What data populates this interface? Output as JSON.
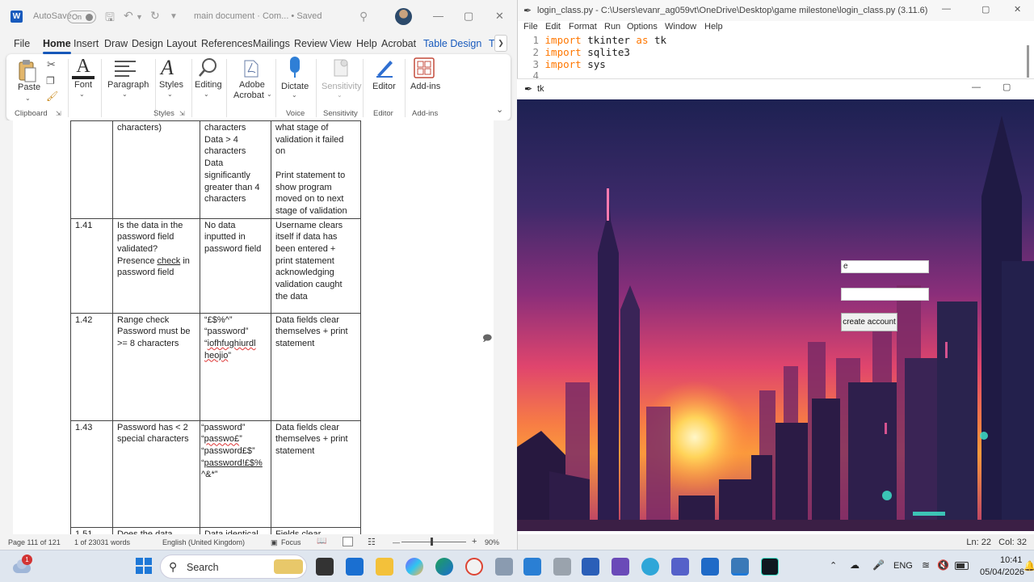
{
  "word": {
    "autosave_label": "AutoSave",
    "autosave_state": "On",
    "doc_title": "main document  ·  Com...  •  Saved",
    "menu": [
      "File",
      "Home",
      "Insert",
      "Draw",
      "Design",
      "Layout",
      "References",
      "Mailings",
      "Review",
      "View",
      "Help",
      "Acrobat",
      "Table Design",
      "T"
    ],
    "ribbon": {
      "paste": "Paste",
      "font": "Font",
      "paragraph": "Paragraph",
      "styles": "Styles",
      "editing": "Editing",
      "adobe1": "Adobe",
      "adobe2": "Acrobat",
      "dictate": "Dictate",
      "sensitivity": "Sensitivity",
      "editor": "Editor",
      "addins": "Add-ins",
      "grp_clipboard": "Clipboard",
      "grp_styles": "Styles",
      "grp_voice": "Voice",
      "grp_sensitivity": "Sensitivity",
      "grp_editor": "Editor",
      "grp_addins": "Add-ins"
    },
    "table": {
      "r0": {
        "c1": "characters)",
        "c2": "characters\nData > 4\ncharacters\nData\nsignificantly\ngreater than 4\ncharacters",
        "c3": "what stage of\nvalidation it failed\non\n\nPrint statement to\nshow program\nmoved on to next\nstage of validation"
      },
      "r1": {
        "id": "1.41",
        "c1a": "Is the data in the\npassword field\nvalidated?\nPresence ",
        "c1b": "check",
        "c1c": " in\npassword field",
        "c2": "No data\ninputted in\npassword field",
        "c3": "Username clears\nitself if data has\nbeen entered +\nprint statement\nacknowledging\nvalidation caught\nthe data"
      },
      "r2": {
        "id": "1.42",
        "c1": "Range check\nPassword must be\n>= 8 characters",
        "c2a": "“£$%^”\n“password”\n“",
        "c2b": "iofhfughiurdl\nheojio",
        "c2c": "”",
        "c3": "Data fields clear\nthemselves + print\nstatement"
      },
      "r3": {
        "id": "1.43",
        "c1": "Password has < 2\nspecial characters",
        "c2a": "“password”\n“",
        "c2b": "passwo£",
        "c2c": "”\n“password£$”\n“",
        "c2d": "password!£$%",
        "c2e": "\n^&*”",
        "c3": "Data fields clear\nthemselves + print\nstatement"
      },
      "r4": {
        "id": "1.51",
        "c1": "Does the data",
        "c2": "Data identical",
        "c3": "Fields clear"
      }
    },
    "status": {
      "page": "Page 111 of 121",
      "words": "1 of 23031 words",
      "language": "English (United Kingdom)",
      "focus": "Focus",
      "zoom": "90%"
    }
  },
  "idle": {
    "title": "login_class.py - C:\\Users\\evanr_ag059vt\\OneDrive\\Desktop\\game milestone\\login_class.py (3.11.6)",
    "menu": [
      "File",
      "Edit",
      "Format",
      "Run",
      "Options",
      "Window",
      "Help"
    ],
    "lines": [
      {
        "n": "1",
        "kw": "import",
        "rest": " tkinter ",
        "kw2": "as",
        "rest2": " tk"
      },
      {
        "n": "2",
        "kw": "import",
        "rest": " sqlite3",
        "kw2": "",
        "rest2": ""
      },
      {
        "n": "3",
        "kw": "import",
        "rest": " sys",
        "kw2": "",
        "rest2": ""
      },
      {
        "n": "4",
        "kw": "",
        "rest": "",
        "kw2": "",
        "rest2": ""
      }
    ],
    "status": "Ln: 22   Col: 32"
  },
  "tk": {
    "title": "tk",
    "entry1_value": "e",
    "entry2_value": "",
    "button_label": "create account"
  },
  "taskbar": {
    "search": "Search",
    "notification_count": "1",
    "lang": "ENG",
    "time": "10:41",
    "date": "05/04/2026"
  }
}
